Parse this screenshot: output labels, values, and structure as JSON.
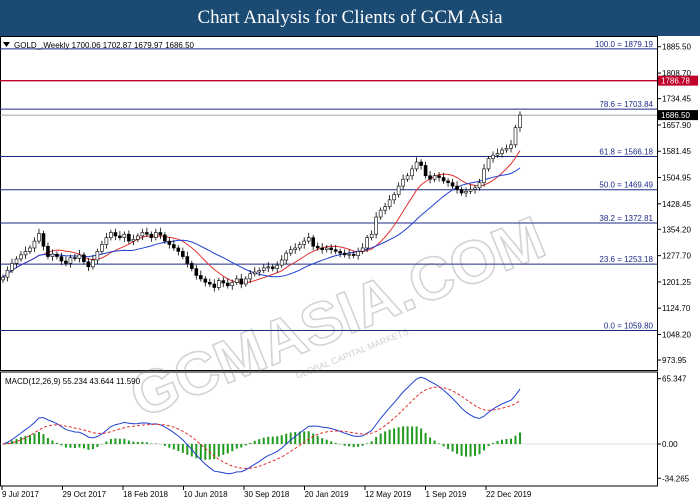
{
  "header": {
    "title": "Chart Analysis for Clients of GCM Asia"
  },
  "watermark": {
    "text": "GCMASIA.COM",
    "sub": "GLOBAL CAPITAL MARKETS"
  },
  "colors": {
    "header_bg": "#1b4a73",
    "resistance_line": "#c0002b",
    "fib_line": "#1c2a86",
    "ma_red": "#e03030",
    "ma_blue": "#2040d0",
    "macd_line": "#2040d0",
    "signal_line": "#e03030",
    "hist": "#1f9a1f",
    "current_price_bg": "#000000"
  },
  "chart_data": [
    {
      "type": "candlestick",
      "info": "GOLD_,Weekly  1700.06 1702.87 1679.97 1686.50",
      "ylim": [
        945,
        1905
      ],
      "y_ticks": [
        1885.5,
        1808.7,
        1734.45,
        1657.9,
        1581.45,
        1504.95,
        1428.45,
        1354.2,
        1277.7,
        1201.25,
        1124.7,
        1048.2,
        973.95
      ],
      "x_ticks": [
        "9 Jul 2017",
        "29 Oct 2017",
        "18 Feb 2018",
        "10 Jun 2018",
        "30 Sep 2018",
        "20 Jan 2019",
        "12 May 2019",
        "1 Sep 2019",
        "22 Dec 2019"
      ],
      "fib_levels": [
        {
          "label": "100.0 = 1879.19",
          "value": 1879.19
        },
        {
          "label": "78.6 = 1703.84",
          "value": 1703.84
        },
        {
          "label": "61.8 = 1566.18",
          "value": 1566.18
        },
        {
          "label": "50.0 = 1469.49",
          "value": 1469.49
        },
        {
          "label": "38.2 = 1372.81",
          "value": 1372.81
        },
        {
          "label": "23.6 = 1253.18",
          "value": 1253.18
        },
        {
          "label": "0.0 = 1059.80",
          "value": 1059.8
        }
      ],
      "resistance": {
        "label": "1786.78",
        "value": 1786.78
      },
      "current": {
        "label": "1686.50",
        "value": 1686.5
      },
      "closes": [
        1215,
        1235,
        1255,
        1268,
        1280,
        1290,
        1300,
        1320,
        1342,
        1305,
        1275,
        1282,
        1275,
        1262,
        1255,
        1272,
        1270,
        1280,
        1260,
        1245,
        1265,
        1290,
        1310,
        1330,
        1345,
        1335,
        1330,
        1340,
        1320,
        1325,
        1335,
        1345,
        1340,
        1330,
        1345,
        1338,
        1320,
        1310,
        1300,
        1290,
        1275,
        1255,
        1240,
        1220,
        1210,
        1200,
        1195,
        1185,
        1205,
        1198,
        1190,
        1200,
        1210,
        1195,
        1210,
        1225,
        1230,
        1235,
        1242,
        1245,
        1240,
        1250,
        1265,
        1285,
        1295,
        1300,
        1310,
        1320,
        1330,
        1305,
        1300,
        1295,
        1300,
        1295,
        1290,
        1285,
        1280,
        1282,
        1278,
        1290,
        1300,
        1330,
        1340,
        1390,
        1410,
        1420,
        1440,
        1455,
        1480,
        1500,
        1510,
        1530,
        1550,
        1540,
        1510,
        1500,
        1510,
        1505,
        1495,
        1490,
        1480,
        1470,
        1460,
        1465,
        1470,
        1475,
        1490,
        1530,
        1560,
        1570,
        1575,
        1585,
        1590,
        1600,
        1650,
        1686.5
      ]
    },
    {
      "type": "line",
      "info": "MACD(12,26,9) 55.234 43.644 11.590",
      "ylim": [
        -40,
        70
      ],
      "y_ticks": [
        65.347,
        0.0,
        -34.265
      ]
    }
  ]
}
